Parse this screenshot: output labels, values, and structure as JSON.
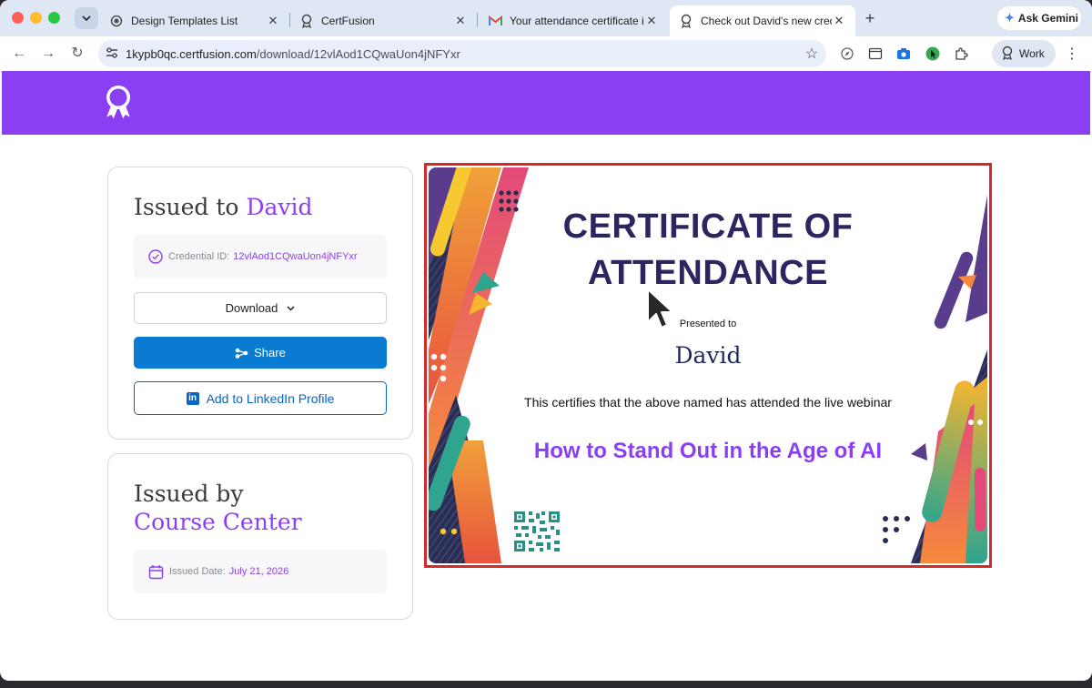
{
  "browser": {
    "tabs": [
      {
        "label": "Design Templates List",
        "icon": "openai-icon"
      },
      {
        "label": "CertFusion",
        "icon": "ribbon-icon"
      },
      {
        "label": "Your attendance certificate is",
        "icon": "gmail-icon"
      },
      {
        "label": "Check out David's new crede",
        "icon": "ribbon-icon",
        "active": true
      }
    ],
    "ask_gemini": "Ask Gemini",
    "url_host": "1kypb0qc.certfusion.com",
    "url_path": "/download/12vlAod1CQwaUon4jNFYxr",
    "profile_label": "Work"
  },
  "credential_card": {
    "issued_to_prefix": "Issued to",
    "recipient": "David",
    "credential_id_label": "Credential ID:",
    "credential_id": "12vlAod1CQwaUon4jNFYxr",
    "download_label": "Download",
    "share_label": "Share",
    "linkedin_label": "Add to LinkedIn Profile"
  },
  "issuer_card": {
    "issued_by_prefix": "Issued by",
    "issuer": "Course Center",
    "issued_date_label": "Issued Date:",
    "issued_date": "July 21, 2026"
  },
  "certificate": {
    "title_line1": "CERTIFICATE OF",
    "title_line2": "ATTENDANCE",
    "presented_to": "Presented to",
    "recipient": "David",
    "certifies": "This certifies that the above named has attended the live webinar",
    "webinar_title": "How to Stand Out in the Age of AI"
  },
  "colors": {
    "brand_purple": "#8b3ff2",
    "share_blue": "#0a7bd1",
    "linkedin_blue": "#0a66c2",
    "highlight_red": "#d42a2a"
  }
}
